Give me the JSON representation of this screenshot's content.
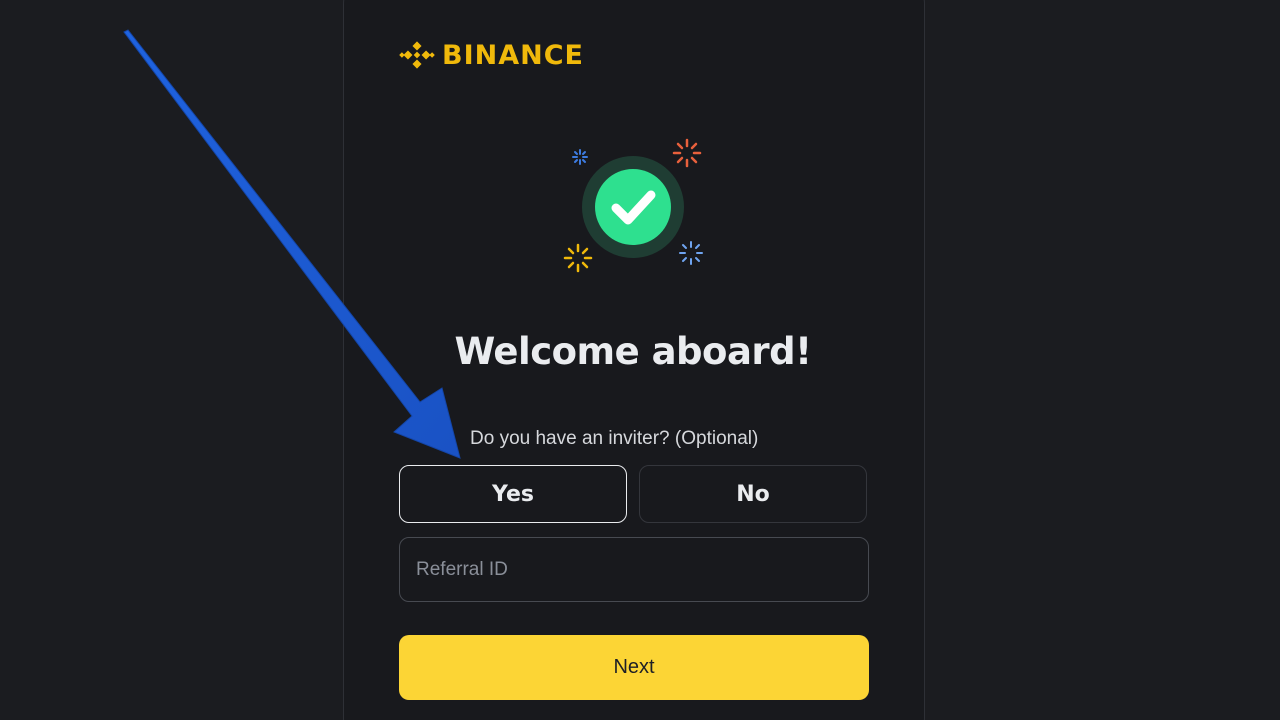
{
  "brand": {
    "name": "BINANCE",
    "color": "#f0b90b"
  },
  "hero": {
    "icon": "checkmark-success-icon",
    "accent": "#2ecc8f"
  },
  "title": "Welcome aboard!",
  "inviter": {
    "question": "Do you have an inviter? (Optional)",
    "yes_label": "Yes",
    "no_label": "No",
    "selected": "Yes"
  },
  "referral": {
    "placeholder": "Referral ID",
    "value": ""
  },
  "next_label": "Next",
  "colors": {
    "background": "#1b1c20",
    "button_primary": "#fcd535",
    "annotation_arrow": "#1e5bd1"
  },
  "annotation": {
    "icon": "arrow-pointer-icon"
  }
}
